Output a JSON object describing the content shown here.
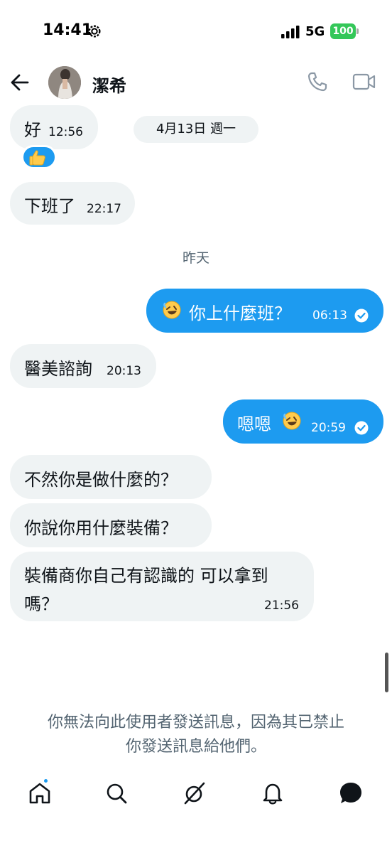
{
  "status_bar": {
    "time": "14:41",
    "network": "5G",
    "battery": "100"
  },
  "header": {
    "contact_name": "潔希",
    "icons": [
      "back-arrow-icon",
      "phone-icon",
      "video-icon"
    ]
  },
  "messages": [
    {
      "direction": "incoming",
      "text": "好",
      "time": "12:56",
      "reaction": "thumbs-up"
    },
    {
      "direction": "incoming",
      "text": "下班了",
      "time": "22:17"
    },
    {
      "direction": "outgoing",
      "text": "你上什麼班？",
      "time": "06:13",
      "emoji": "rofl"
    },
    {
      "direction": "incoming",
      "text": "醫美諮詢",
      "time": "20:13"
    },
    {
      "direction": "outgoing",
      "text": "嗯嗯",
      "time": "20:59",
      "emoji": "rofl"
    },
    {
      "direction": "incoming",
      "text": "不然你是做什麼的？"
    },
    {
      "direction": "incoming",
      "text": "你說你用什麼裝備？"
    },
    {
      "direction": "incoming",
      "text_line1": "裝備商你自己有認識的 可以拿到",
      "text_line2": "嗎？",
      "time": "21:56"
    }
  ],
  "date_separators": {
    "date_pill": "4月13日 週一",
    "yesterday": "昨天"
  },
  "blocked_notice": {
    "line1": "你無法向此使用者發送訊息，因為其已禁止",
    "line2": "你發送訊息給他們。"
  },
  "bottom_nav": [
    "home-icon",
    "search-icon",
    "grok-icon",
    "notifications-icon",
    "messages-icon"
  ],
  "colors": {
    "accent": "#1d9bf0",
    "incoming_bubble": "#eff3f4",
    "muted_text": "#536471",
    "battery_green": "#34c759"
  }
}
